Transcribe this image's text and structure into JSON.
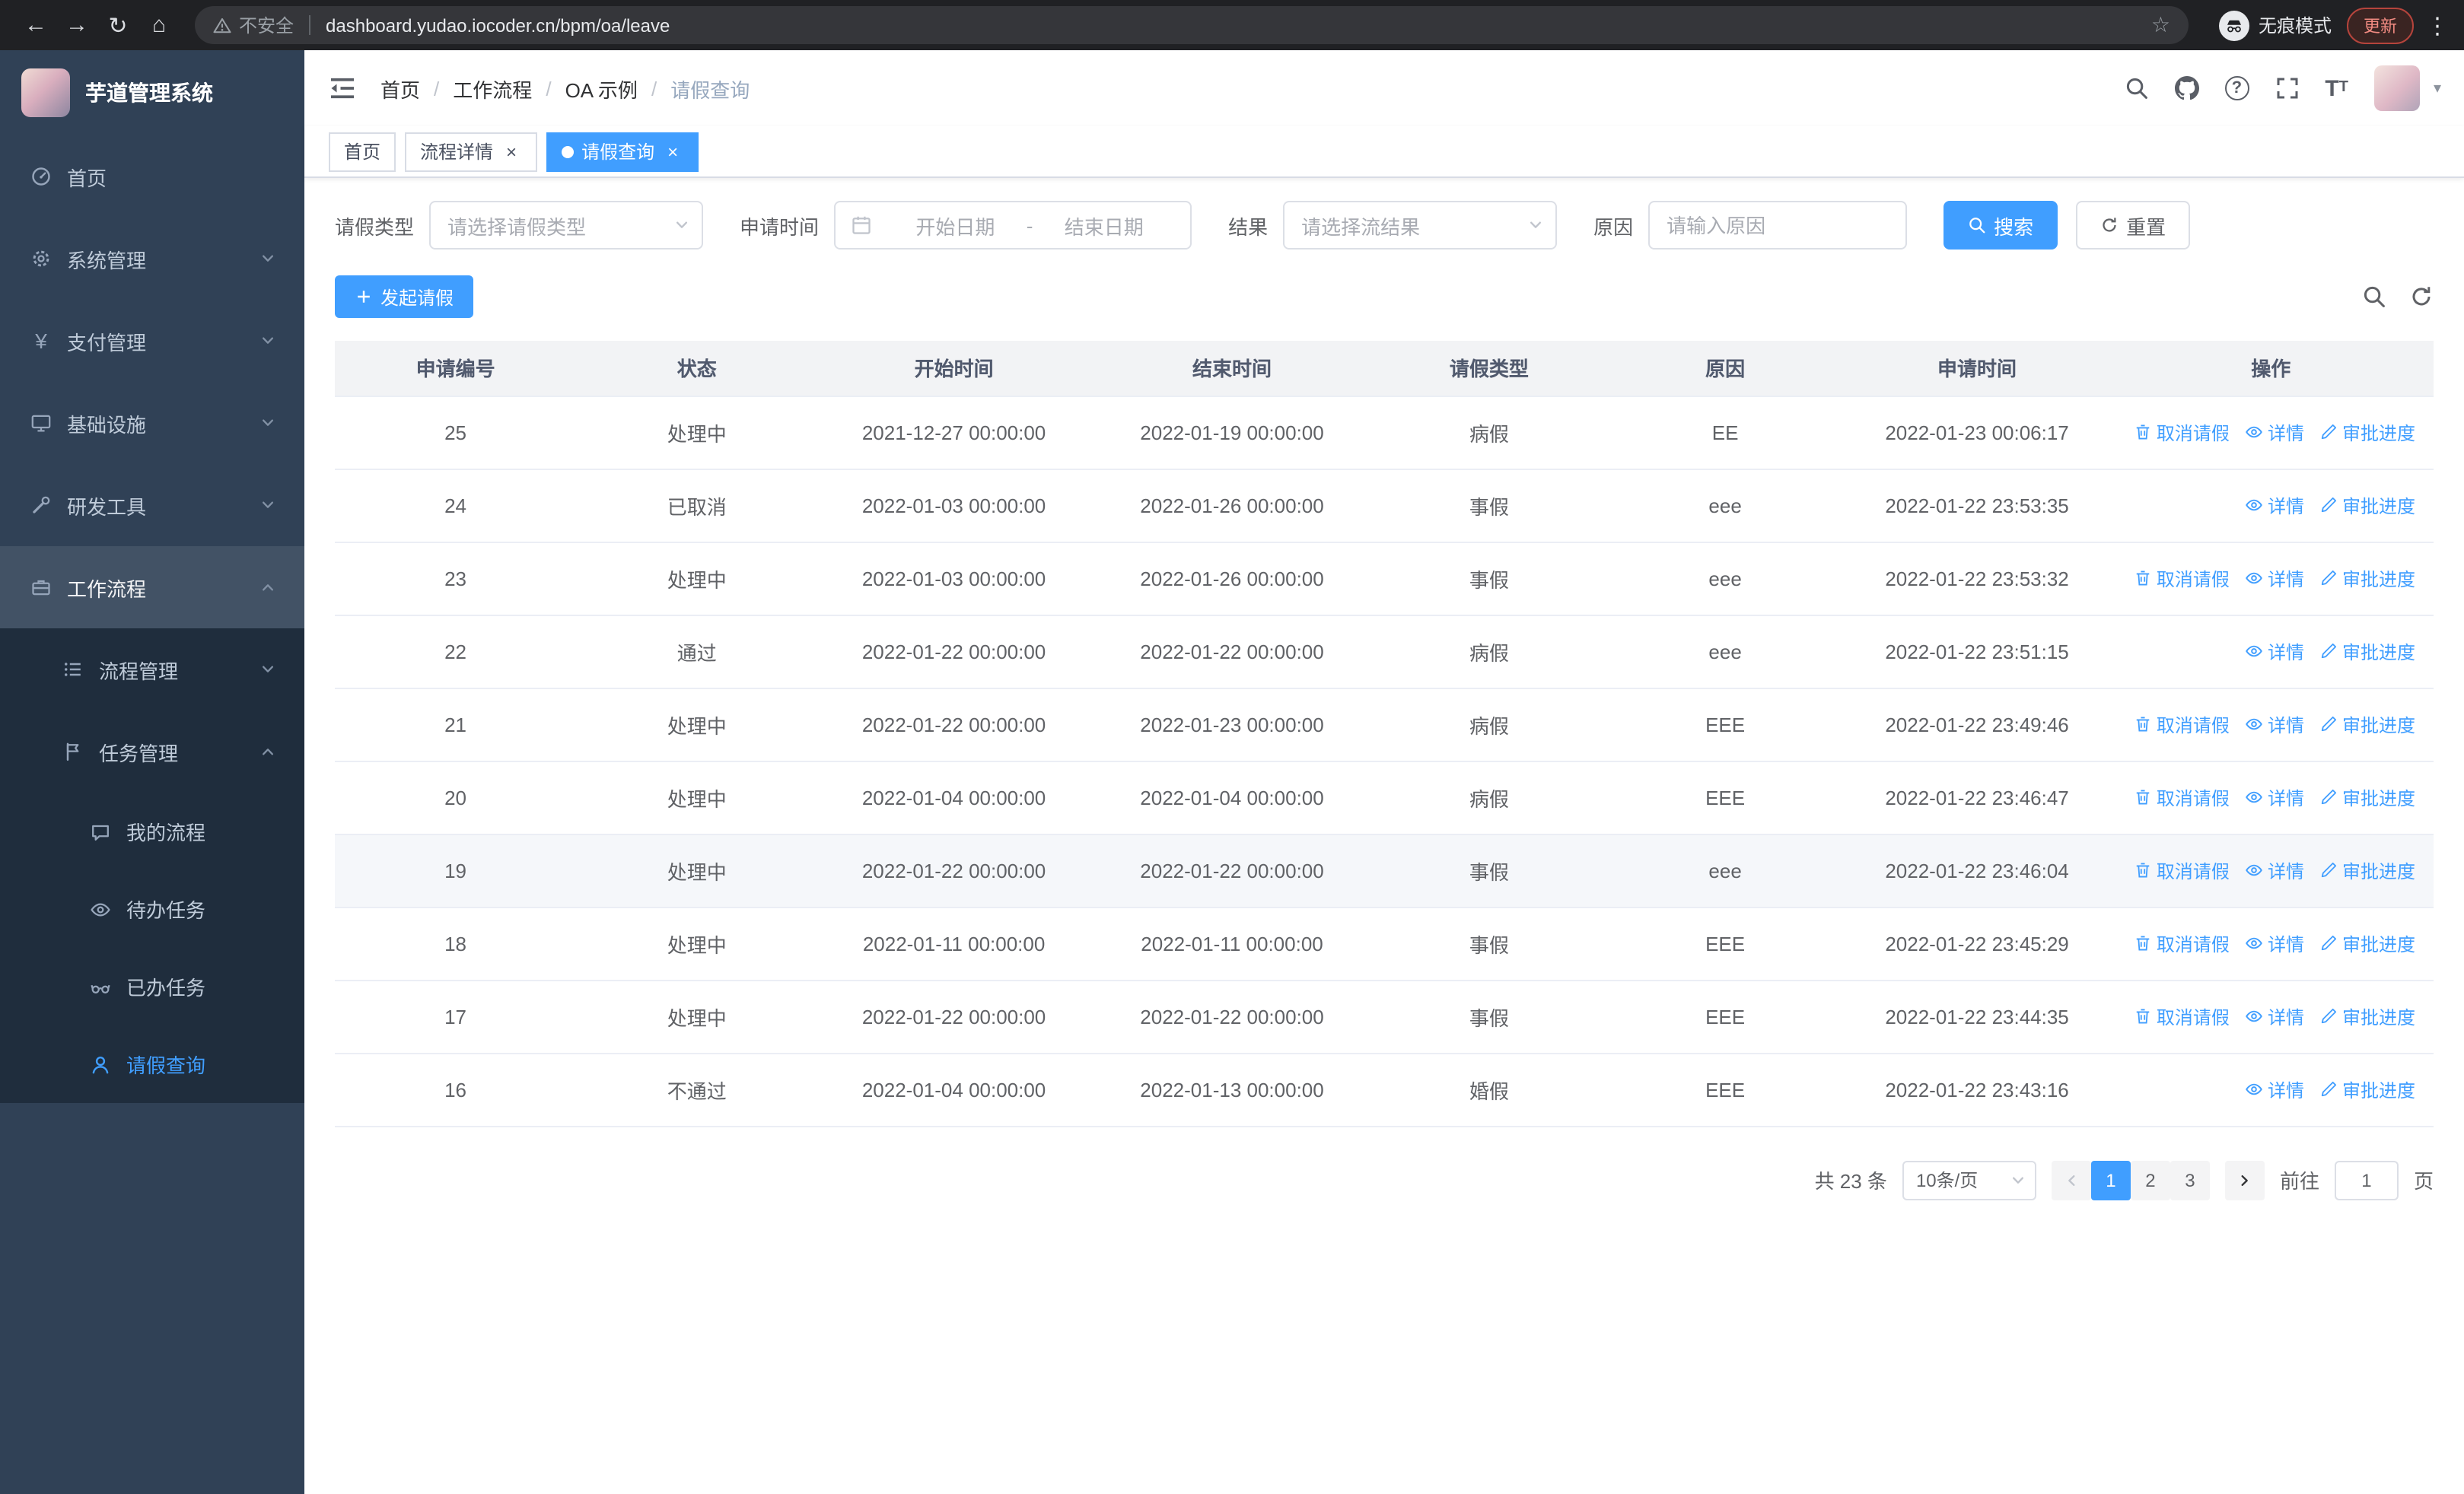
{
  "browser": {
    "security_label": "不安全",
    "url": "dashboard.yudao.iocoder.cn/bpm/oa/leave",
    "incognito_label": "无痕模式",
    "update_label": "更新"
  },
  "sidebar": {
    "title": "芋道管理系统",
    "items": [
      {
        "label": "首页"
      },
      {
        "label": "系统管理"
      },
      {
        "label": "支付管理"
      },
      {
        "label": "基础设施"
      },
      {
        "label": "研发工具"
      },
      {
        "label": "工作流程"
      },
      {
        "label": "流程管理"
      },
      {
        "label": "任务管理"
      },
      {
        "label": "我的流程"
      },
      {
        "label": "待办任务"
      },
      {
        "label": "已办任务"
      },
      {
        "label": "请假查询"
      }
    ]
  },
  "breadcrumb": {
    "items": [
      "首页",
      "工作流程",
      "OA 示例",
      "请假查询"
    ]
  },
  "tabs": [
    {
      "label": "首页"
    },
    {
      "label": "流程详情"
    },
    {
      "label": "请假查询"
    }
  ],
  "filters": {
    "leave_type_label": "请假类型",
    "leave_type_placeholder": "请选择请假类型",
    "apply_time_label": "申请时间",
    "start_date_placeholder": "开始日期",
    "date_separator": "-",
    "end_date_placeholder": "结束日期",
    "result_label": "结果",
    "result_placeholder": "请选择流结果",
    "reason_label": "原因",
    "reason_placeholder": "请输入原因",
    "search_label": "搜索",
    "reset_label": "重置"
  },
  "toolbar": {
    "create_label": "发起请假"
  },
  "table": {
    "columns": [
      "申请编号",
      "状态",
      "开始时间",
      "结束时间",
      "请假类型",
      "原因",
      "申请时间",
      "操作"
    ],
    "action_labels": {
      "cancel": "取消请假",
      "detail": "详情",
      "progress": "审批进度"
    },
    "rows": [
      {
        "id": "25",
        "status": "处理中",
        "start_time": "2021-12-27 00:00:00",
        "end_time": "2022-01-19 00:00:00",
        "leave_type": "病假",
        "reason": "EE",
        "apply_time": "2022-01-23 00:06:17",
        "actions": [
          "cancel",
          "detail",
          "progress"
        ],
        "highlighted": false
      },
      {
        "id": "24",
        "status": "已取消",
        "start_time": "2022-01-03 00:00:00",
        "end_time": "2022-01-26 00:00:00",
        "leave_type": "事假",
        "reason": "eee",
        "apply_time": "2022-01-22 23:53:35",
        "actions": [
          "detail",
          "progress"
        ],
        "highlighted": false
      },
      {
        "id": "23",
        "status": "处理中",
        "start_time": "2022-01-03 00:00:00",
        "end_time": "2022-01-26 00:00:00",
        "leave_type": "事假",
        "reason": "eee",
        "apply_time": "2022-01-22 23:53:32",
        "actions": [
          "cancel",
          "detail",
          "progress"
        ],
        "highlighted": false
      },
      {
        "id": "22",
        "status": "通过",
        "start_time": "2022-01-22 00:00:00",
        "end_time": "2022-01-22 00:00:00",
        "leave_type": "病假",
        "reason": "eee",
        "apply_time": "2022-01-22 23:51:15",
        "actions": [
          "detail",
          "progress"
        ],
        "highlighted": false
      },
      {
        "id": "21",
        "status": "处理中",
        "start_time": "2022-01-22 00:00:00",
        "end_time": "2022-01-23 00:00:00",
        "leave_type": "病假",
        "reason": "EEE",
        "apply_time": "2022-01-22 23:49:46",
        "actions": [
          "cancel",
          "detail",
          "progress"
        ],
        "highlighted": false
      },
      {
        "id": "20",
        "status": "处理中",
        "start_time": "2022-01-04 00:00:00",
        "end_time": "2022-01-04 00:00:00",
        "leave_type": "病假",
        "reason": "EEE",
        "apply_time": "2022-01-22 23:46:47",
        "actions": [
          "cancel",
          "detail",
          "progress"
        ],
        "highlighted": false
      },
      {
        "id": "19",
        "status": "处理中",
        "start_time": "2022-01-22 00:00:00",
        "end_time": "2022-01-22 00:00:00",
        "leave_type": "事假",
        "reason": "eee",
        "apply_time": "2022-01-22 23:46:04",
        "actions": [
          "cancel",
          "detail",
          "progress"
        ],
        "highlighted": true
      },
      {
        "id": "18",
        "status": "处理中",
        "start_time": "2022-01-11 00:00:00",
        "end_time": "2022-01-11 00:00:00",
        "leave_type": "事假",
        "reason": "EEE",
        "apply_time": "2022-01-22 23:45:29",
        "actions": [
          "cancel",
          "detail",
          "progress"
        ],
        "highlighted": false
      },
      {
        "id": "17",
        "status": "处理中",
        "start_time": "2022-01-22 00:00:00",
        "end_time": "2022-01-22 00:00:00",
        "leave_type": "事假",
        "reason": "EEE",
        "apply_time": "2022-01-22 23:44:35",
        "actions": [
          "cancel",
          "detail",
          "progress"
        ],
        "highlighted": false
      },
      {
        "id": "16",
        "status": "不通过",
        "start_time": "2022-01-04 00:00:00",
        "end_time": "2022-01-13 00:00:00",
        "leave_type": "婚假",
        "reason": "EEE",
        "apply_time": "2022-01-22 23:43:16",
        "actions": [
          "detail",
          "progress"
        ],
        "highlighted": false
      }
    ]
  },
  "pagination": {
    "total_label": "共 23 条",
    "page_size_label": "10条/页",
    "pages": [
      "1",
      "2",
      "3"
    ],
    "current_page": "1",
    "goto_label": "前往",
    "goto_value": "1",
    "page_unit": "页"
  },
  "colors": {
    "primary": "#409eff",
    "sidebar_bg": "#304156",
    "submenu_bg": "#1f2d3d",
    "browser_bg": "#202124"
  }
}
